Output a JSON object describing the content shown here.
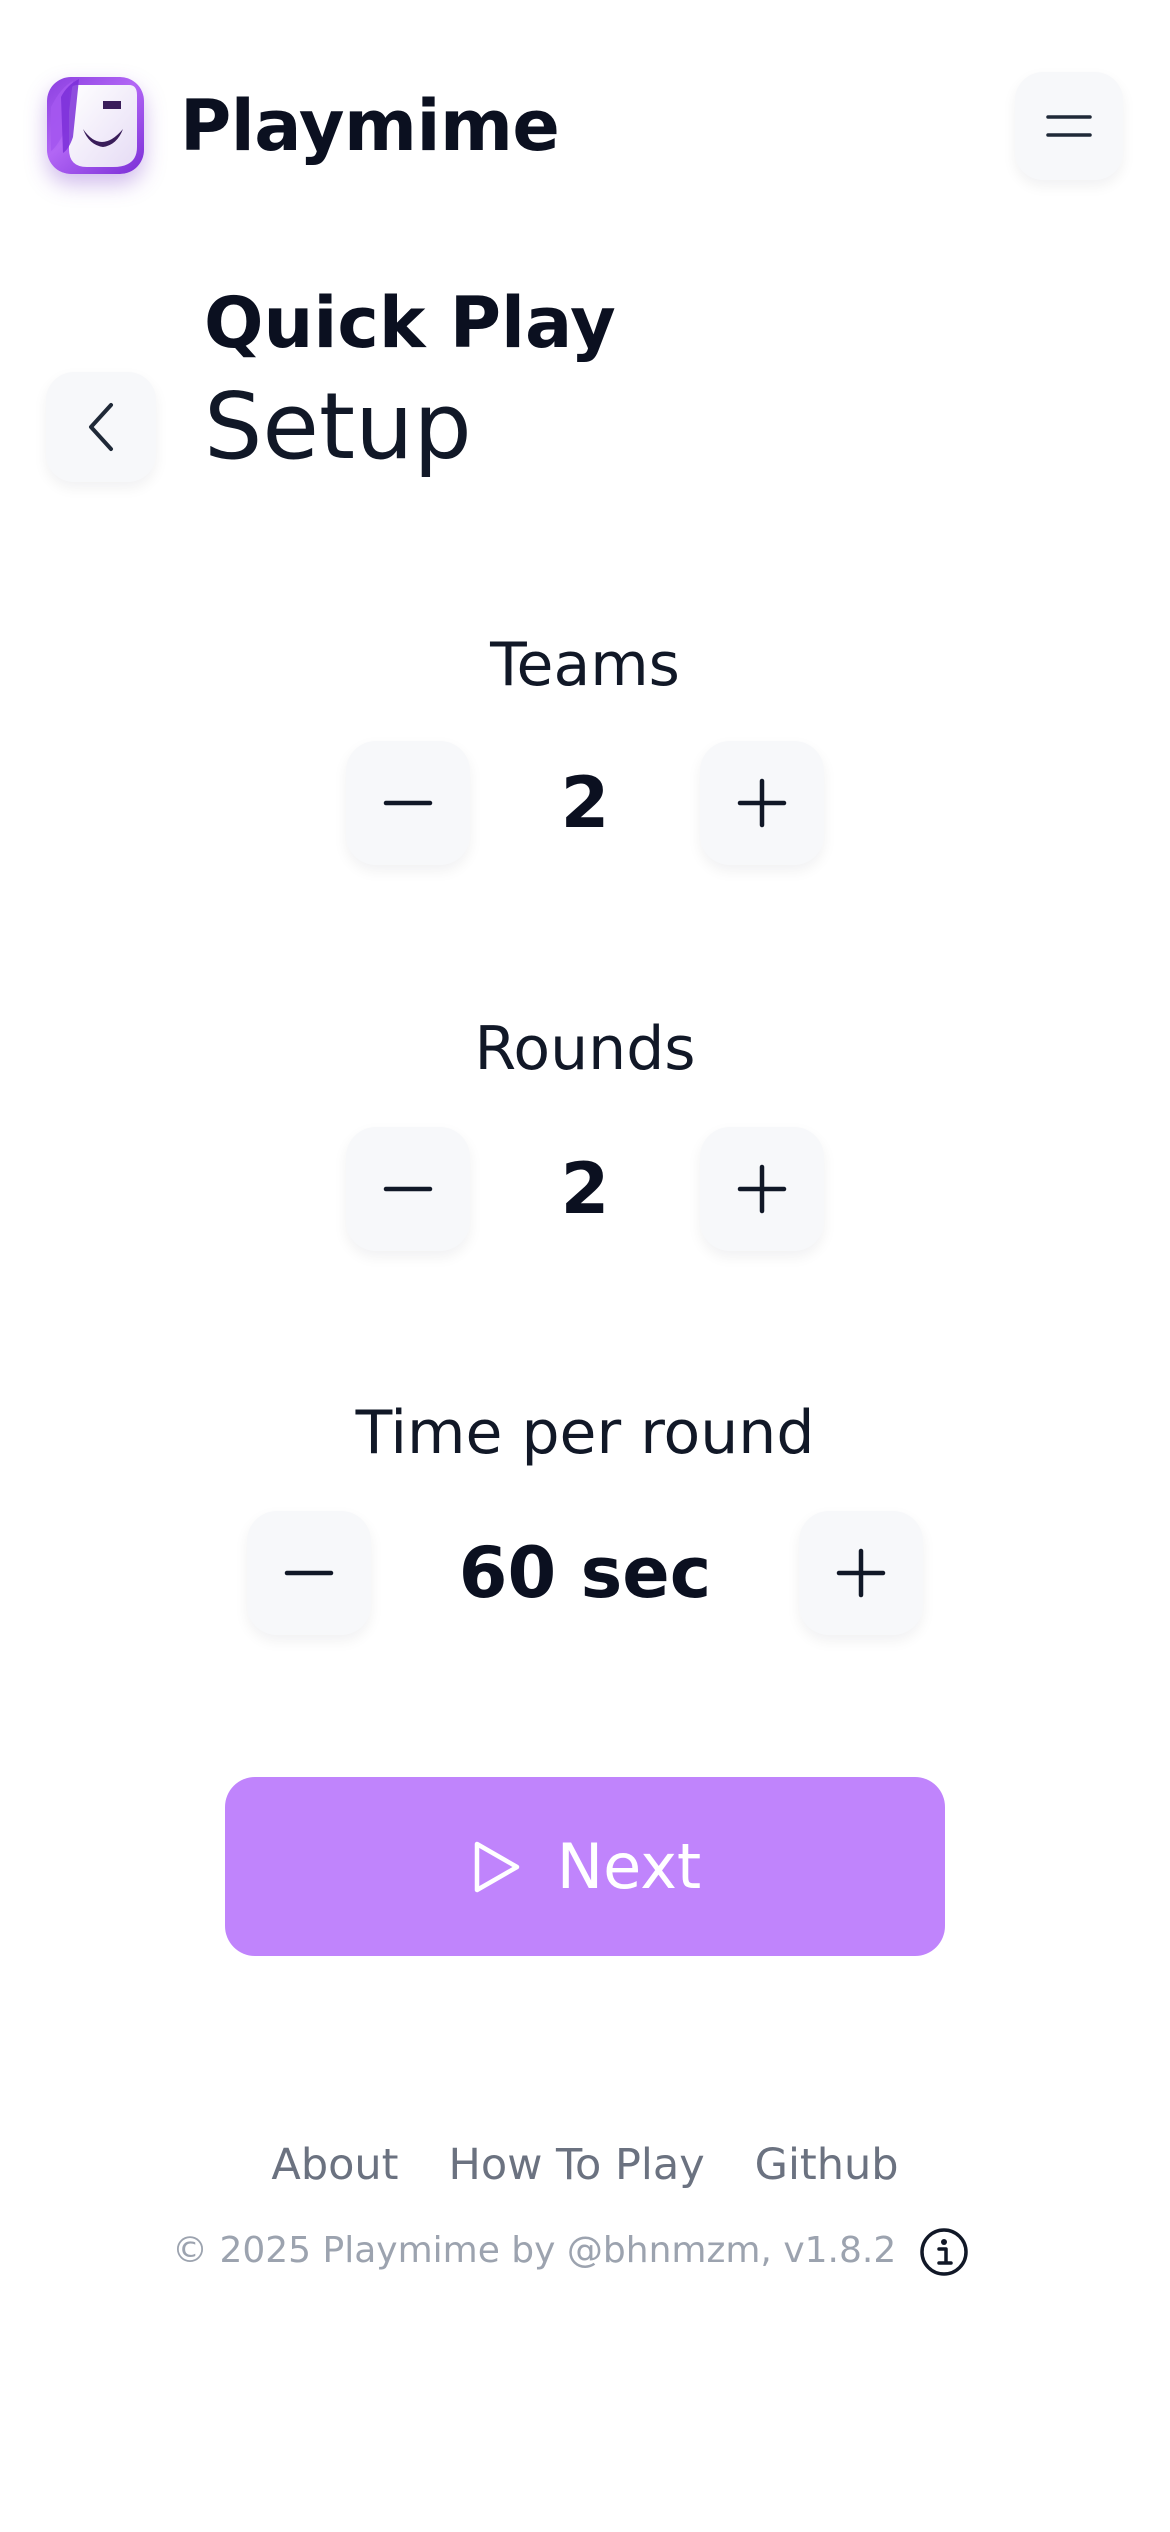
{
  "header": {
    "app_title": "Playmime",
    "logo_icon": "playmime-logo",
    "menu_icon": "hamburger-menu-icon"
  },
  "heading": {
    "title": "Quick Play",
    "subtitle": "Setup",
    "back_icon": "chevron-left-icon"
  },
  "settings": {
    "teams": {
      "label": "Teams",
      "value": "2"
    },
    "rounds": {
      "label": "Rounds",
      "value": "2"
    },
    "time": {
      "label": "Time per round",
      "value": "60 sec"
    }
  },
  "actions": {
    "next_label": "Next",
    "next_icon": "play-icon"
  },
  "footer": {
    "links": [
      "About",
      "How To Play",
      "Github"
    ],
    "copyright": "© 2025 Playmime by @bhnmzm, v1.8.2",
    "info_icon": "info-icon"
  },
  "colors": {
    "primary_button": "#c084fc",
    "logo_gradient_start": "#8b3fe0",
    "text_dark": "#0b1020",
    "button_surface": "#f7f8fa",
    "muted_text": "#6b7280"
  }
}
